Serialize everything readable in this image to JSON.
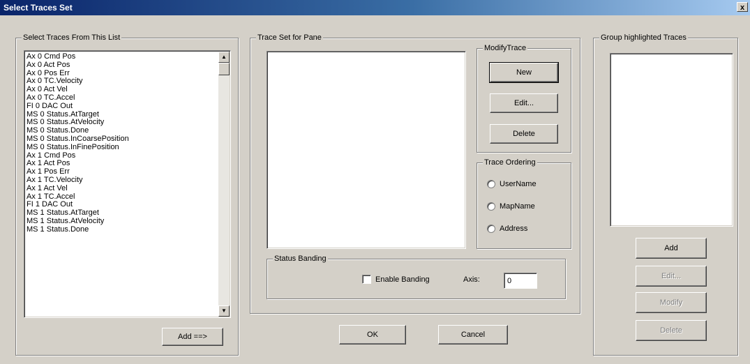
{
  "window": {
    "title": "Select Traces Set",
    "close_glyph": "x"
  },
  "left_panel": {
    "legend": "Select Traces From This List",
    "items": [
      "Ax 0 Cmd Pos",
      "Ax 0 Act Pos",
      "Ax 0 Pos Err",
      "Ax 0 TC.Velocity",
      "Ax 0 Act Vel",
      "Ax 0 TC.Accel",
      "FI 0 DAC Out",
      "MS 0 Status.AtTarget",
      "MS 0 Status.AtVelocity",
      "MS 0 Status.Done",
      "MS 0 Status.InCoarsePosition",
      "MS 0 Status.InFinePosition",
      "Ax 1 Cmd Pos",
      "Ax 1 Act Pos",
      "Ax 1 Pos Err",
      "Ax 1 TC.Velocity",
      "Ax 1 Act Vel",
      "Ax 1 TC.Accel",
      "FI 1 DAC Out",
      "MS 1 Status.AtTarget",
      "MS 1 Status.AtVelocity",
      "MS 1 Status.Done"
    ],
    "add_button": "Add ==>"
  },
  "trace_set": {
    "legend": "Trace Set for Pane",
    "modify": {
      "legend": "ModifyTrace",
      "new": "New",
      "edit": "Edit...",
      "delete": "Delete"
    },
    "ordering": {
      "legend": "Trace Ordering",
      "options": [
        "UserName",
        "MapName",
        "Address"
      ]
    },
    "banding": {
      "legend": "Status Banding",
      "checkbox_label": "Enable Banding",
      "axis_label": "Axis:",
      "axis_value": "0"
    }
  },
  "group": {
    "legend": "Group highlighted Traces",
    "add": "Add",
    "edit": "Edit...",
    "modify": "Modify",
    "delete": "Delete"
  },
  "footer": {
    "ok": "OK",
    "cancel": "Cancel"
  }
}
